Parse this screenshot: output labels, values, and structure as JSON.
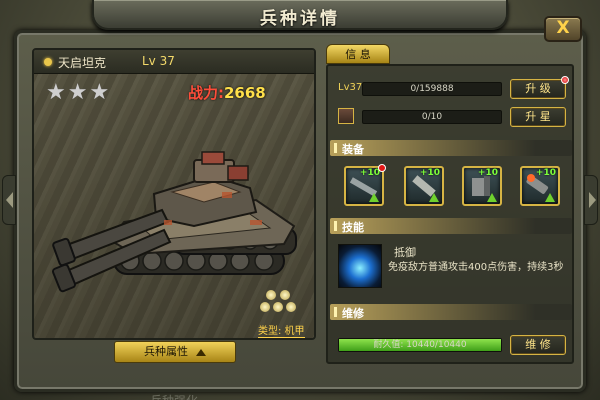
{
  "window": {
    "title": "兵种详情",
    "close_label": "X"
  },
  "unit": {
    "name": "天启坦克",
    "level": "Lv 37",
    "stars": [
      "★",
      "★",
      "★"
    ],
    "power_label": "战力:",
    "power_value": "2668",
    "type": "类型: 机甲",
    "attr_tab": "兵种属性"
  },
  "info": {
    "tab": "信 息",
    "level_label": "Lv37",
    "exp_text": "0/159888",
    "exp_fraction": 0,
    "upgrade_label": "升 级",
    "star_text": "0/10",
    "star_fraction": 0,
    "star_up_label": "升 星"
  },
  "equipment": {
    "heading": "装备",
    "items": [
      {
        "icon": "cannon-barrel-icon",
        "bonus": "+10",
        "has_alert": true
      },
      {
        "icon": "armor-plate-icon",
        "bonus": "+10",
        "has_alert": false
      },
      {
        "icon": "engine-part-icon",
        "bonus": "+10",
        "has_alert": false
      },
      {
        "icon": "shell-ammo-icon",
        "bonus": "+10",
        "has_alert": false
      }
    ]
  },
  "skill": {
    "heading": "技能",
    "name": "抵御",
    "description": "免疫敌方普通攻击400点伤害，持续3秒"
  },
  "repair": {
    "heading": "维修",
    "durability_text": "耐久值: 10440/10440",
    "durability_fraction": 1,
    "repair_label": "维 修"
  },
  "footer_ghost": "兵种强化"
}
